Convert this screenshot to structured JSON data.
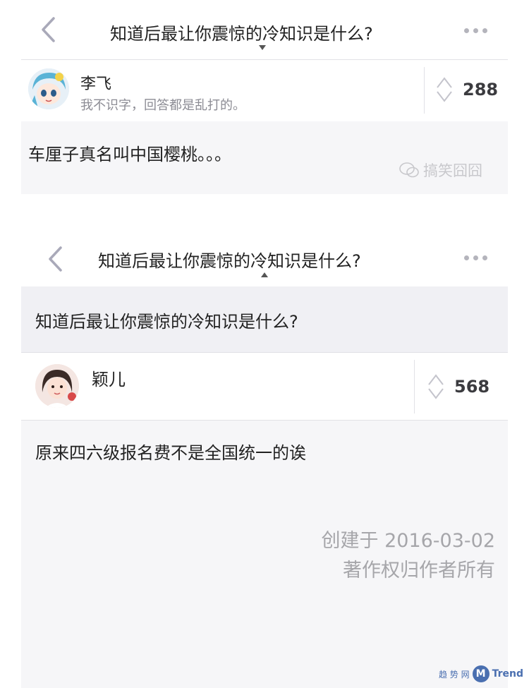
{
  "screen1": {
    "nav_title": "知道后最让你震惊的冷知识是什么?",
    "author_name": "李飞",
    "author_bio": "我不识字，回答都是乱打的。",
    "vote_count": "288",
    "answer_text": "车厘子真名叫中国樱桃。。。",
    "watermark": "搞笑囧囧"
  },
  "screen2": {
    "nav_title": "知道后最让你震惊的冷知识是什么?",
    "question_title": "知道后最让你震惊的冷知识是什么?",
    "author_name": "颖儿",
    "vote_count": "568",
    "answer_text": "原来四六级报名费不是全国统一的诶",
    "created": "创建于 2016-03-02",
    "copyright": "著作权归作者所有"
  },
  "brand": {
    "cn": "趋 势 网",
    "mark": "M",
    "name": "Trend"
  },
  "colors": {
    "accent": "#5a4a9a",
    "muted": "#a6a6aa",
    "background_grey": "#f6f6f8"
  }
}
